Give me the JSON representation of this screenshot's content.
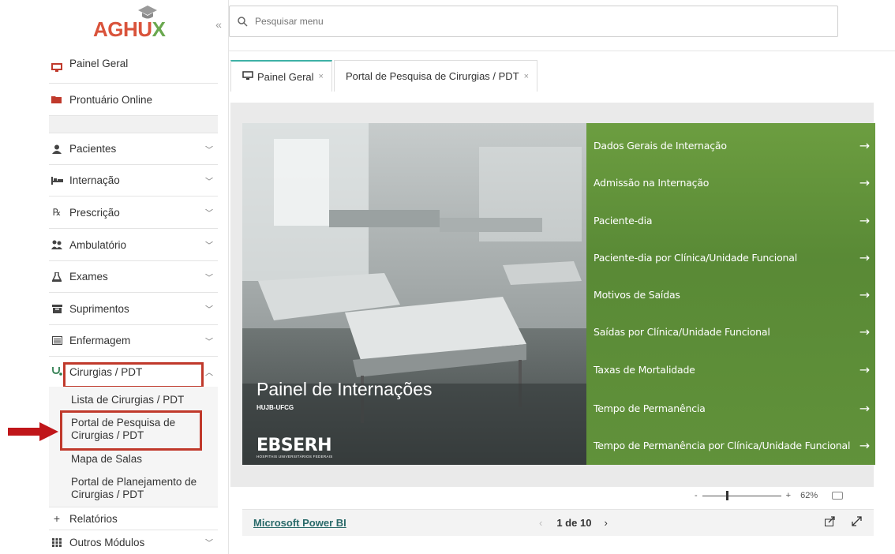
{
  "app": {
    "logo_part1": "AGHU",
    "logo_part2": "X",
    "colors": {
      "accent_red": "#d9533b",
      "accent_green": "#6aa84f",
      "tab_accent": "#3eb1a6",
      "panel_green": "#5e8e39",
      "highlight_red": "#c0392b"
    }
  },
  "sidebar": {
    "top_items": [
      {
        "label": "Painel Geral",
        "icon": "monitor-icon"
      },
      {
        "label": "Prontuário Online",
        "icon": "folder-icon"
      }
    ],
    "menu_items": [
      {
        "label": "Pacientes",
        "icon": "user-icon"
      },
      {
        "label": "Internação",
        "icon": "bed-icon"
      },
      {
        "label": "Prescrição",
        "icon": "rx-icon"
      },
      {
        "label": "Ambulatório",
        "icon": "users-icon"
      },
      {
        "label": "Exames",
        "icon": "flask-icon"
      },
      {
        "label": "Suprimentos",
        "icon": "archive-icon"
      },
      {
        "label": "Enfermagem",
        "icon": "list-icon"
      }
    ],
    "expanded": {
      "label": "Cirurgias / PDT",
      "icon": "stethoscope-icon",
      "children": [
        "Lista de Cirurgias / PDT",
        "Portal de Pesquisa de",
        "Cirurgias / PDT",
        "Mapa de Salas",
        "Portal de Planejamento de",
        "Cirurgias / PDT"
      ]
    },
    "relatorios": "Relatórios",
    "outros": "Outros Módulos"
  },
  "search": {
    "placeholder": "Pesquisar menu"
  },
  "tabs": [
    {
      "label": "Painel Geral"
    },
    {
      "label": "Portal de Pesquisa de Cirurgias / PDT"
    }
  ],
  "report": {
    "title": "Painel de Internações",
    "subtitle": "HUJB-UFCG",
    "brand": "EBSERH",
    "brand_sub": "HOSPITAIS UNIVERSITÁRIOS FEDERAIS",
    "links": [
      "Dados Gerais de Internação",
      "Admissão na Internação",
      "Paciente-dia",
      "Paciente-dia por Clínica/Unidade Funcional",
      "Motivos de Saídas",
      "Saídas por Clínica/Unidade Funcional",
      "Taxas de Mortalidade",
      "Tempo de Permanência",
      "Tempo de Permanência por Clínica/Unidade Funcional"
    ]
  },
  "zoom": {
    "minus": "-",
    "plus": "+",
    "percent": "62%",
    "level": 0.62
  },
  "footer": {
    "powerbi": "Microsoft Power BI",
    "page": "1 de 10"
  }
}
